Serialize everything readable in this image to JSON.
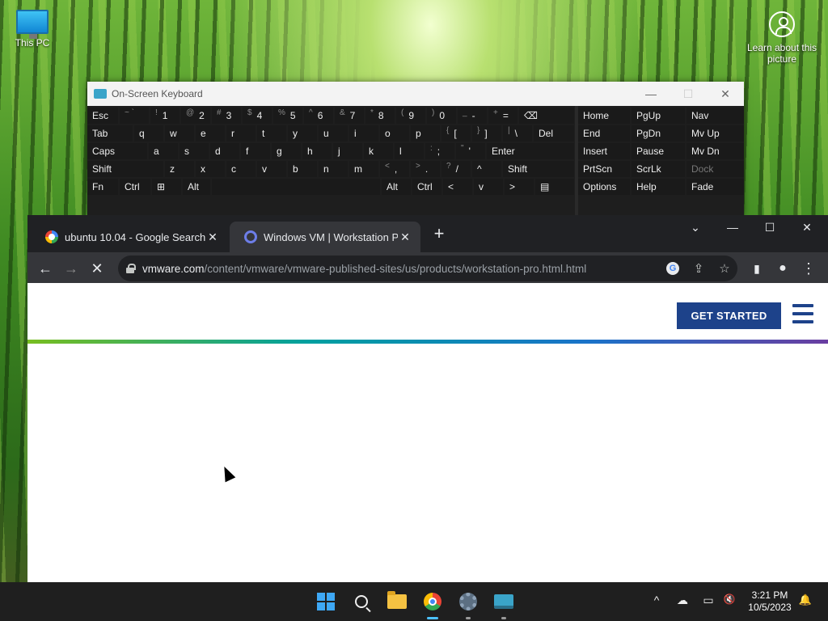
{
  "desktop": {
    "this_pc_label": "This PC",
    "learn_label": "Learn about this picture"
  },
  "osk": {
    "title": "On-Screen Keyboard",
    "controls": {
      "minimize": "—",
      "maximize": "☐",
      "close": "✕"
    },
    "keys": {
      "esc": "Esc",
      "k1_alt": "~ `",
      "k2_alt": "!",
      "k2": "1",
      "k3_alt": "@",
      "k3": "2",
      "k4_alt": "#",
      "k4": "3",
      "k5_alt": "$",
      "k5": "4",
      "k6_alt": "%",
      "k6": "5",
      "k7_alt": "^",
      "k7": "6",
      "k8_alt": "&",
      "k8": "7",
      "k9_alt": "*",
      "k9": "8",
      "k10_alt": "(",
      "k10": "9",
      "k11_alt": ")",
      "k11": "0",
      "k12_alt": "_",
      "k12": "-",
      "k13_alt": "+",
      "k13": "=",
      "backspace": "⌫",
      "tab": "Tab",
      "q": "q",
      "w": "w",
      "e": "e",
      "r": "r",
      "t": "t",
      "y": "y",
      "u": "u",
      "i": "i",
      "o": "o",
      "p": "p",
      "lbr_alt": "{",
      "lbr": "[",
      "rbr_alt": "}",
      "rbr": "]",
      "bsl_alt": "|",
      "bsl": "\\",
      "del": "Del",
      "caps": "Caps",
      "a": "a",
      "s": "s",
      "d": "d",
      "f": "f",
      "g": "g",
      "h": "h",
      "j": "j",
      "k": "k",
      "l": "l",
      "semi_alt": ":",
      "semi": ";",
      "quote_alt": "\"",
      "quote": "'",
      "enter": "Enter",
      "shift": "Shift",
      "z": "z",
      "x": "x",
      "c": "c",
      "v": "v",
      "b": "b",
      "n": "n",
      "m": "m",
      "comma_alt": "<",
      "comma": ",",
      "period_alt": ">",
      "period": ".",
      "slash_alt": "?",
      "slash": "/",
      "up": "^",
      "shift_r": "Shift",
      "fn": "Fn",
      "ctrl": "Ctrl",
      "win": "⊞",
      "alt": "Alt",
      "alt_r": "Alt",
      "ctrl_r": "Ctrl",
      "left": "<",
      "down": "v",
      "right": ">",
      "menu": "▤",
      "home": "Home",
      "pgup": "PgUp",
      "nav": "Nav",
      "end": "End",
      "pgdn": "PgDn",
      "mvup": "Mv Up",
      "insert": "Insert",
      "pause": "Pause",
      "mvdn": "Mv Dn",
      "prtscn": "PrtScn",
      "scrlk": "ScrLk",
      "dock": "Dock",
      "options": "Options",
      "help": "Help",
      "fade": "Fade"
    }
  },
  "chrome": {
    "tabs": [
      {
        "title": "ubuntu 10.04 - Google Search",
        "close": "✕"
      },
      {
        "title": "Windows VM | Workstation Pro |",
        "close": "✕"
      }
    ],
    "new_tab": "+",
    "window_controls": {
      "dropdown": "⌄",
      "minimize": "—",
      "maximize": "☐",
      "close": "✕"
    },
    "toolbar": {
      "back": "←",
      "forward": "→",
      "reload": "✕"
    },
    "url_domain": "vmware.com",
    "url_path": "/content/vmware/vmware-published-sites/us/products/workstation-pro.html.html",
    "omnibox_icons": {
      "google": "G",
      "share": "⇪",
      "bookmark": "☆"
    },
    "side_icons": {
      "sidepanel": "▮",
      "profile": "●",
      "menu": "⋮"
    }
  },
  "page": {
    "get_started": "GET STARTED",
    "brand_color": "#1d428a"
  },
  "taskbar": {
    "tray": {
      "chevron": "^",
      "onedrive": "☁",
      "network": "▭",
      "volume": "🔇",
      "notifications": "🔔"
    },
    "time": "3:21 PM",
    "date": "10/5/2023"
  }
}
